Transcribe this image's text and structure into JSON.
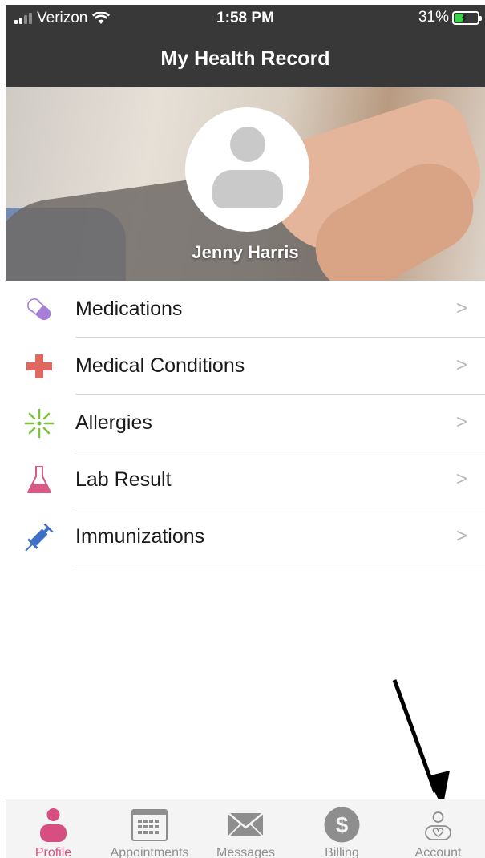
{
  "status_bar": {
    "carrier": "Verizon",
    "time": "1:58 PM",
    "battery": "31%"
  },
  "header": {
    "title": "My Health Record"
  },
  "profile": {
    "name": "Jenny Harris"
  },
  "menu": [
    {
      "label": "Medications",
      "icon": "pill-icon",
      "color": "#a77fd6"
    },
    {
      "label": "Medical Conditions",
      "icon": "medical-cross-icon",
      "color": "#e0685f"
    },
    {
      "label": "Allergies",
      "icon": "allergy-burst-icon",
      "color": "#7dc23f"
    },
    {
      "label": "Lab Result",
      "icon": "lab-flask-icon",
      "color": "#d65a85"
    },
    {
      "label": "Immunizations",
      "icon": "syringe-icon",
      "color": "#3f6fc6"
    }
  ],
  "tabs": [
    {
      "label": "Profile",
      "icon": "profile-icon",
      "active": true
    },
    {
      "label": "Appointments",
      "icon": "calendar-icon",
      "active": false
    },
    {
      "label": "Messages",
      "icon": "envelope-icon",
      "active": false
    },
    {
      "label": "Billing",
      "icon": "dollar-icon",
      "active": false
    },
    {
      "label": "Account",
      "icon": "account-icon",
      "active": false
    }
  ],
  "colors": {
    "header_bg": "#383838",
    "active_tab": "#d74f80",
    "inactive_tab": "#8e8e8e"
  }
}
